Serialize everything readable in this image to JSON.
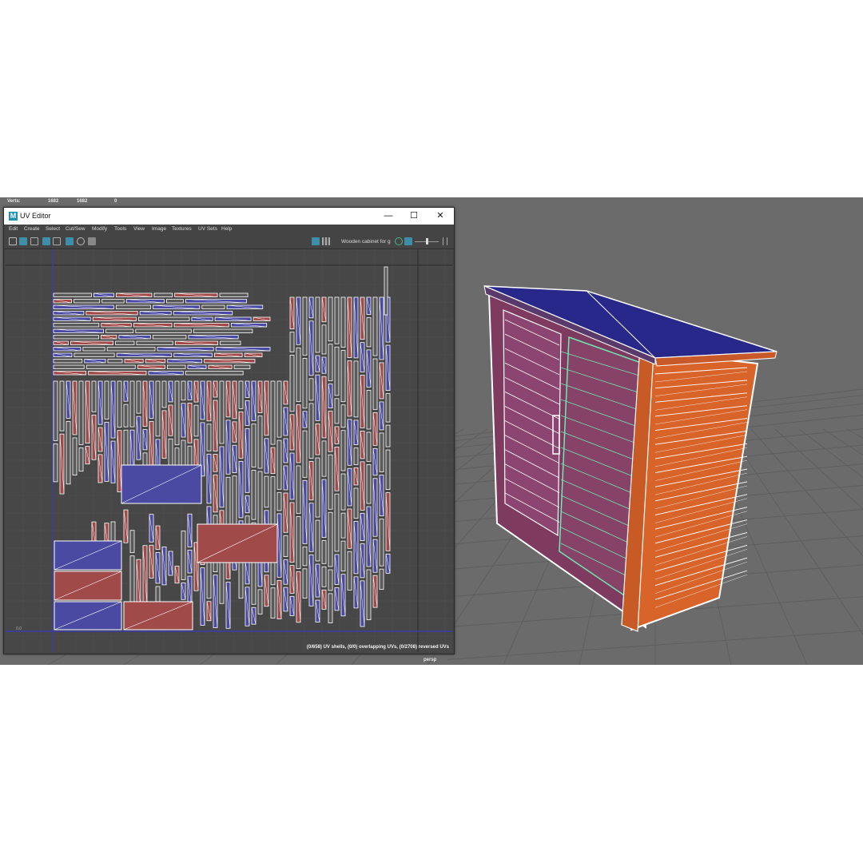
{
  "viewport": {
    "hud": {
      "label": "Verts:",
      "values": [
        "1682",
        "1682",
        "0"
      ]
    },
    "camera_label": "persp",
    "colors": {
      "background": "#6b6b6b",
      "grid": "#5f5f5f"
    }
  },
  "uv_editor": {
    "title": "UV Editor",
    "window_controls": {
      "minimize": "—",
      "maximize": "☐",
      "close": "✕"
    },
    "menu": [
      "Edit",
      "Create",
      "Select",
      "Cut/Sew",
      "Modify",
      "Tools",
      "View",
      "Image",
      "Textures",
      "UV Sets",
      "Help"
    ],
    "toolbar_icons": [
      "uv-shell-icon",
      "checker-map-icon",
      "uv-grid-icon",
      "pin-icon",
      "distortion-icon",
      "texture-toggle-icon",
      "snapshot-icon"
    ],
    "texture_name": "Wooden cabinet for g",
    "status": "(0/658) UV shells, (0/0) overlapping UVs, (0/2708) reversed UVs",
    "colors": {
      "shell_blue": "#4a4aa3",
      "shell_red": "#a14a4a",
      "edge": "#ffffff",
      "axis": "#3a3ac4"
    }
  },
  "model": {
    "colors": {
      "roof": "#2a2a8a",
      "side": "#e0662a",
      "front": "#8a3a64",
      "wire": "#ffffff",
      "selection": "#6ee8b4"
    }
  }
}
